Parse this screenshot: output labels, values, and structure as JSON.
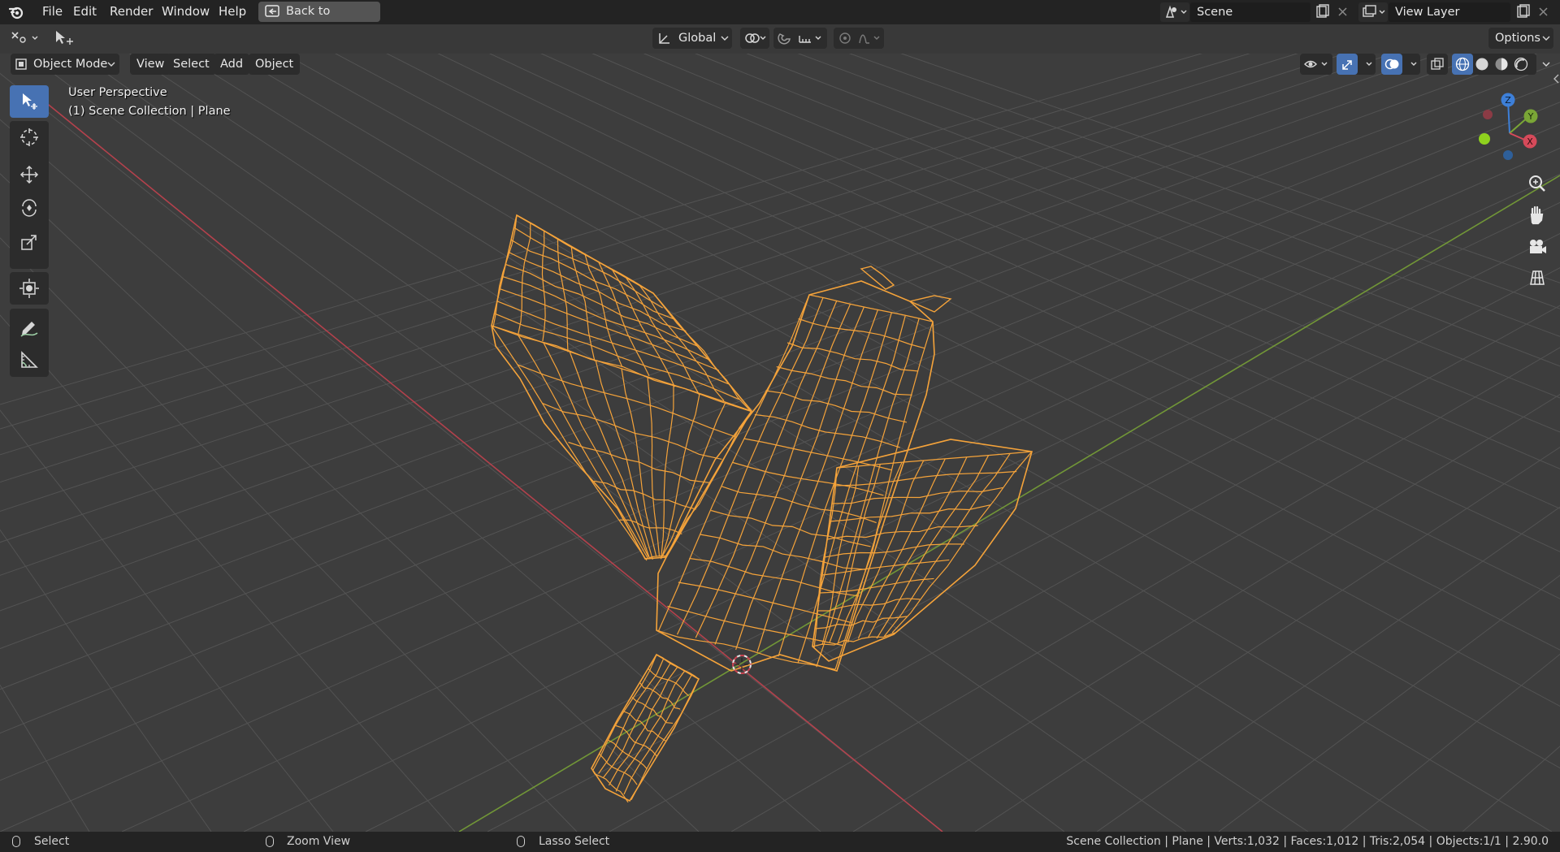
{
  "menubar": {
    "items": [
      "File",
      "Edit",
      "Render",
      "Window",
      "Help"
    ],
    "back_button": "Back to Previous",
    "scene_field": "Scene",
    "view_layer_field": "View Layer"
  },
  "tool_header": {
    "transform_orientation": "Global",
    "options_label": "Options"
  },
  "viewport_header": {
    "mode": "Object Mode",
    "menus": [
      "View",
      "Select",
      "Add",
      "Object"
    ]
  },
  "viewport": {
    "view_name": "User Perspective",
    "collection_info": "(1) Scene Collection | Plane",
    "gizmo_axes": {
      "z": "Z",
      "y": "Y",
      "x": "X"
    },
    "colors": {
      "wire": "#f5a33a",
      "x_axis": "#c8424f",
      "y_axis": "#7aa636",
      "grid": "#535353",
      "active_tool": "#4772b3"
    }
  },
  "toolbar": {
    "tools": [
      "select-box",
      "cursor",
      "move",
      "rotate",
      "scale",
      "transform",
      "annotate",
      "measure"
    ]
  },
  "statusbar": {
    "left_action": "Select",
    "middle_action": "Zoom View",
    "right_action": "Lasso Select",
    "stats": "Scene Collection | Plane | Verts:1,032 | Faces:1,012 | Tris:2,054 | Objects:1/1 | 2.90.0"
  }
}
